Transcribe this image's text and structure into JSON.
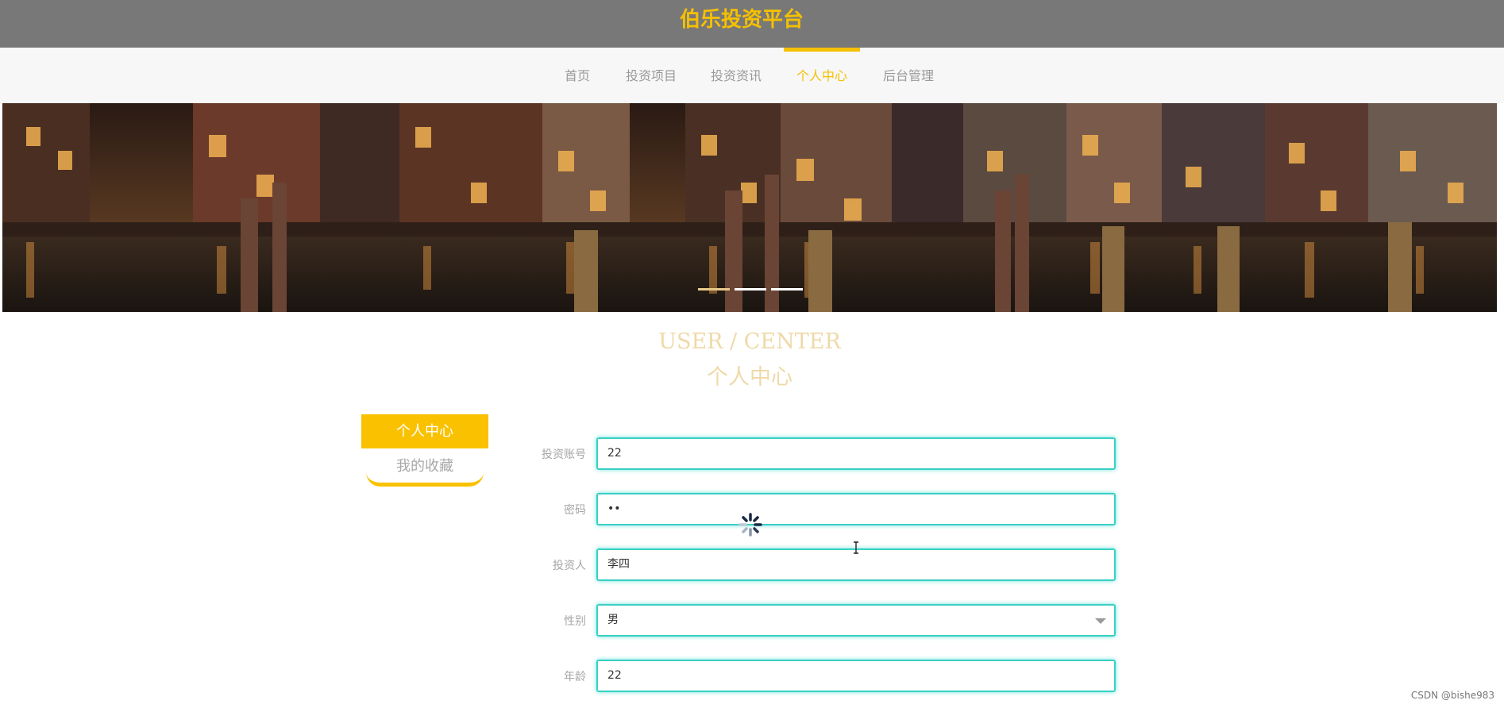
{
  "header": {
    "site_title": "伯乐投资平台"
  },
  "nav": {
    "items": [
      {
        "label": "首页",
        "active": false
      },
      {
        "label": "投资项目",
        "active": false
      },
      {
        "label": "投资资讯",
        "active": false
      },
      {
        "label": "个人中心",
        "active": true
      },
      {
        "label": "后台管理",
        "active": false
      }
    ]
  },
  "banner": {
    "slide_count": 3,
    "active_slide": 1
  },
  "section": {
    "title_en": "USER / CENTER",
    "title_cn": "个人中心"
  },
  "sidebar": {
    "items": [
      {
        "label": "个人中心",
        "active": true
      },
      {
        "label": "我的收藏",
        "active": false
      }
    ]
  },
  "form": {
    "fields": [
      {
        "label": "投资账号",
        "value": "22"
      },
      {
        "label": "密码",
        "value": "••"
      },
      {
        "label": "投资人",
        "value": "李四"
      },
      {
        "label": "性别",
        "value": "男"
      },
      {
        "label": "年龄",
        "value": "22"
      }
    ]
  },
  "footer": {
    "watermark": "CSDN @bishe983"
  },
  "colors": {
    "accent": "#f5c000",
    "input_border": "#3ad0c5",
    "topbar": "#787878"
  },
  "icons": {
    "loading": "spinner-icon",
    "select": "chevron-down-icon",
    "cursor": "text-cursor-icon"
  }
}
